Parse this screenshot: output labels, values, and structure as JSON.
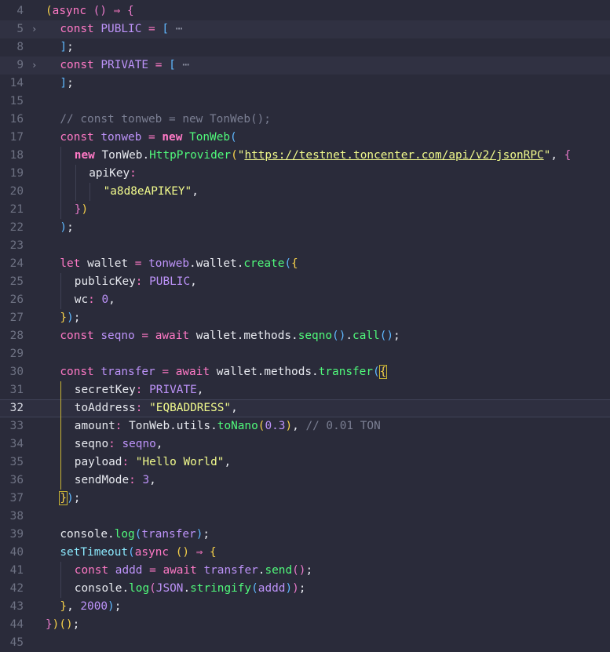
{
  "editor": {
    "lines": [
      {
        "n": 4,
        "indent": 0,
        "tokens": [
          [
            "(",
            "p1"
          ],
          [
            "async",
            "kw"
          ],
          [
            " ",
            "plain"
          ],
          [
            "()",
            "p2"
          ],
          [
            " ",
            "plain"
          ],
          [
            "⇒",
            "op"
          ],
          [
            " ",
            "plain"
          ],
          [
            "{",
            "p2"
          ]
        ]
      },
      {
        "n": 5,
        "indent": 1,
        "fold": true,
        "hl": true,
        "tokens": [
          [
            "const",
            "kw"
          ],
          [
            " ",
            "plain"
          ],
          [
            "PUBLIC",
            "const"
          ],
          [
            " ",
            "plain"
          ],
          [
            "=",
            "op"
          ],
          [
            " ",
            "plain"
          ],
          [
            "[",
            "p3"
          ],
          [
            " ",
            "plain"
          ],
          [
            "⋯",
            "ellipsis"
          ]
        ]
      },
      {
        "n": 8,
        "indent": 1,
        "tokens": [
          [
            "]",
            "p3"
          ],
          [
            ";",
            "plain"
          ]
        ]
      },
      {
        "n": 9,
        "indent": 1,
        "fold": true,
        "hl": true,
        "tokens": [
          [
            "const",
            "kw"
          ],
          [
            " ",
            "plain"
          ],
          [
            "PRIVATE",
            "const"
          ],
          [
            " ",
            "plain"
          ],
          [
            "=",
            "op"
          ],
          [
            " ",
            "plain"
          ],
          [
            "[",
            "p3"
          ],
          [
            " ",
            "plain"
          ],
          [
            "⋯",
            "ellipsis"
          ]
        ]
      },
      {
        "n": 14,
        "indent": 1,
        "tokens": [
          [
            "]",
            "p3"
          ],
          [
            ";",
            "plain"
          ]
        ]
      },
      {
        "n": 15,
        "indent": 1,
        "tokens": []
      },
      {
        "n": 16,
        "indent": 1,
        "tokens": [
          [
            "// const tonweb = new TonWeb();",
            "cmt"
          ]
        ]
      },
      {
        "n": 17,
        "indent": 1,
        "tokens": [
          [
            "const",
            "kw"
          ],
          [
            " ",
            "plain"
          ],
          [
            "tonweb",
            "var"
          ],
          [
            " ",
            "plain"
          ],
          [
            "=",
            "op"
          ],
          [
            " ",
            "plain"
          ],
          [
            "new",
            "new"
          ],
          [
            " ",
            "plain"
          ],
          [
            "TonWeb",
            "fn"
          ],
          [
            "(",
            "p3"
          ]
        ]
      },
      {
        "n": 18,
        "indent": 2,
        "tokens": [
          [
            "new",
            "new"
          ],
          [
            " ",
            "plain"
          ],
          [
            "TonWeb",
            "plain"
          ],
          [
            ".",
            "plain"
          ],
          [
            "HttpProvider",
            "fn"
          ],
          [
            "(",
            "p1"
          ],
          [
            "\"",
            "str"
          ],
          [
            "https://testnet.toncenter.com/api/v2/jsonRPC",
            "url"
          ],
          [
            "\"",
            "str"
          ],
          [
            ", ",
            "plain"
          ],
          [
            "{",
            "p2"
          ]
        ]
      },
      {
        "n": 19,
        "indent": 3,
        "tokens": [
          [
            "apiKey",
            "key"
          ],
          [
            ":",
            "op"
          ]
        ]
      },
      {
        "n": 20,
        "indent": 4,
        "tokens": [
          [
            "\"a8d8eAPIKEY\"",
            "str"
          ],
          [
            ",",
            "plain"
          ]
        ]
      },
      {
        "n": 21,
        "indent": 2,
        "tokens": [
          [
            "}",
            "p2"
          ],
          [
            ")",
            "p1"
          ]
        ]
      },
      {
        "n": 22,
        "indent": 1,
        "tokens": [
          [
            ")",
            "p3"
          ],
          [
            ";",
            "plain"
          ]
        ]
      },
      {
        "n": 23,
        "indent": 1,
        "tokens": []
      },
      {
        "n": 24,
        "indent": 1,
        "tokens": [
          [
            "let",
            "kw"
          ],
          [
            " ",
            "plain"
          ],
          [
            "wallet",
            "plain"
          ],
          [
            " ",
            "plain"
          ],
          [
            "=",
            "op"
          ],
          [
            " ",
            "plain"
          ],
          [
            "tonweb",
            "var"
          ],
          [
            ".",
            "plain"
          ],
          [
            "wallet",
            "plain"
          ],
          [
            ".",
            "plain"
          ],
          [
            "create",
            "fn"
          ],
          [
            "(",
            "p3"
          ],
          [
            "{",
            "p1"
          ]
        ]
      },
      {
        "n": 25,
        "indent": 2,
        "tokens": [
          [
            "publicKey",
            "key"
          ],
          [
            ":",
            "op"
          ],
          [
            " ",
            "plain"
          ],
          [
            "PUBLIC",
            "const"
          ],
          [
            ",",
            "plain"
          ]
        ]
      },
      {
        "n": 26,
        "indent": 2,
        "tokens": [
          [
            "wc",
            "key"
          ],
          [
            ":",
            "op"
          ],
          [
            " ",
            "plain"
          ],
          [
            "0",
            "num"
          ],
          [
            ",",
            "plain"
          ]
        ]
      },
      {
        "n": 27,
        "indent": 1,
        "tokens": [
          [
            "}",
            "p1"
          ],
          [
            ")",
            "p3"
          ],
          [
            ";",
            "plain"
          ]
        ]
      },
      {
        "n": 28,
        "indent": 1,
        "tokens": [
          [
            "const",
            "kw"
          ],
          [
            " ",
            "plain"
          ],
          [
            "seqno",
            "var"
          ],
          [
            " ",
            "plain"
          ],
          [
            "=",
            "op"
          ],
          [
            " ",
            "plain"
          ],
          [
            "await",
            "kw"
          ],
          [
            " ",
            "plain"
          ],
          [
            "wallet",
            "plain"
          ],
          [
            ".",
            "plain"
          ],
          [
            "methods",
            "plain"
          ],
          [
            ".",
            "plain"
          ],
          [
            "seqno",
            "fn"
          ],
          [
            "()",
            "p3"
          ],
          [
            ".",
            "plain"
          ],
          [
            "call",
            "fn"
          ],
          [
            "()",
            "p3"
          ],
          [
            ";",
            "plain"
          ]
        ]
      },
      {
        "n": 29,
        "indent": 1,
        "tokens": []
      },
      {
        "n": 30,
        "indent": 1,
        "tokens": [
          [
            "const",
            "kw"
          ],
          [
            " ",
            "plain"
          ],
          [
            "transfer",
            "var"
          ],
          [
            " ",
            "plain"
          ],
          [
            "=",
            "op"
          ],
          [
            " ",
            "plain"
          ],
          [
            "await",
            "kw"
          ],
          [
            " ",
            "plain"
          ],
          [
            "wallet",
            "plain"
          ],
          [
            ".",
            "plain"
          ],
          [
            "methods",
            "plain"
          ],
          [
            ".",
            "plain"
          ],
          [
            "transfer",
            "fn"
          ],
          [
            "(",
            "p3"
          ],
          [
            "{",
            "p1 box"
          ]
        ]
      },
      {
        "n": 31,
        "indent": 2,
        "active": true,
        "tokens": [
          [
            "secretKey",
            "key"
          ],
          [
            ":",
            "op"
          ],
          [
            " ",
            "plain"
          ],
          [
            "PRIVATE",
            "const"
          ],
          [
            ",",
            "plain"
          ]
        ]
      },
      {
        "n": 32,
        "indent": 2,
        "active": true,
        "cur": true,
        "tokens": [
          [
            "toAddress",
            "key"
          ],
          [
            ":",
            "op"
          ],
          [
            " ",
            "plain"
          ],
          [
            "\"EQBADDRESS\"",
            "str"
          ],
          [
            ",",
            "plain"
          ]
        ]
      },
      {
        "n": 33,
        "indent": 2,
        "active": true,
        "tokens": [
          [
            "amount",
            "key"
          ],
          [
            ":",
            "op"
          ],
          [
            " ",
            "plain"
          ],
          [
            "TonWeb",
            "plain"
          ],
          [
            ".",
            "plain"
          ],
          [
            "utils",
            "plain"
          ],
          [
            ".",
            "plain"
          ],
          [
            "toNano",
            "fn"
          ],
          [
            "(",
            "p1"
          ],
          [
            "0.3",
            "num"
          ],
          [
            ")",
            "p1"
          ],
          [
            ", ",
            "plain"
          ],
          [
            "// 0.01 TON",
            "cmt"
          ]
        ]
      },
      {
        "n": 34,
        "indent": 2,
        "active": true,
        "tokens": [
          [
            "seqno",
            "key"
          ],
          [
            ":",
            "op"
          ],
          [
            " ",
            "plain"
          ],
          [
            "seqno",
            "var"
          ],
          [
            ",",
            "plain"
          ]
        ]
      },
      {
        "n": 35,
        "indent": 2,
        "active": true,
        "tokens": [
          [
            "payload",
            "key"
          ],
          [
            ":",
            "op"
          ],
          [
            " ",
            "plain"
          ],
          [
            "\"Hello World\"",
            "str"
          ],
          [
            ",",
            "plain"
          ]
        ]
      },
      {
        "n": 36,
        "indent": 2,
        "active": true,
        "tokens": [
          [
            "sendMode",
            "key"
          ],
          [
            ":",
            "op"
          ],
          [
            " ",
            "plain"
          ],
          [
            "3",
            "num"
          ],
          [
            ",",
            "plain"
          ]
        ]
      },
      {
        "n": 37,
        "indent": 1,
        "tokens": [
          [
            "}",
            "p1 box"
          ],
          [
            ")",
            "p3"
          ],
          [
            ";",
            "plain"
          ]
        ]
      },
      {
        "n": 38,
        "indent": 1,
        "tokens": []
      },
      {
        "n": 39,
        "indent": 1,
        "tokens": [
          [
            "console",
            "plain"
          ],
          [
            ".",
            "plain"
          ],
          [
            "log",
            "fn"
          ],
          [
            "(",
            "p3"
          ],
          [
            "transfer",
            "var"
          ],
          [
            ")",
            "p3"
          ],
          [
            ";",
            "plain"
          ]
        ]
      },
      {
        "n": 40,
        "indent": 1,
        "tokens": [
          [
            "setTimeout",
            "cls"
          ],
          [
            "(",
            "p3"
          ],
          [
            "async",
            "kw"
          ],
          [
            " ",
            "plain"
          ],
          [
            "()",
            "p1"
          ],
          [
            " ",
            "plain"
          ],
          [
            "⇒",
            "op"
          ],
          [
            " ",
            "plain"
          ],
          [
            "{",
            "p1"
          ]
        ]
      },
      {
        "n": 41,
        "indent": 2,
        "tokens": [
          [
            "const",
            "kw"
          ],
          [
            " ",
            "plain"
          ],
          [
            "addd",
            "var"
          ],
          [
            " ",
            "plain"
          ],
          [
            "=",
            "op"
          ],
          [
            " ",
            "plain"
          ],
          [
            "await",
            "kw"
          ],
          [
            " ",
            "plain"
          ],
          [
            "transfer",
            "var"
          ],
          [
            ".",
            "plain"
          ],
          [
            "send",
            "fn"
          ],
          [
            "()",
            "p2"
          ],
          [
            ";",
            "plain"
          ]
        ]
      },
      {
        "n": 42,
        "indent": 2,
        "tokens": [
          [
            "console",
            "plain"
          ],
          [
            ".",
            "plain"
          ],
          [
            "log",
            "fn"
          ],
          [
            "(",
            "p2"
          ],
          [
            "JSON",
            "const"
          ],
          [
            ".",
            "plain"
          ],
          [
            "stringify",
            "fn"
          ],
          [
            "(",
            "p3"
          ],
          [
            "addd",
            "var"
          ],
          [
            ")",
            "p3"
          ],
          [
            ")",
            "p2"
          ],
          [
            ";",
            "plain"
          ]
        ]
      },
      {
        "n": 43,
        "indent": 1,
        "tokens": [
          [
            "}",
            "p1"
          ],
          [
            ", ",
            "plain"
          ],
          [
            "2000",
            "num"
          ],
          [
            ")",
            "p3"
          ],
          [
            ";",
            "plain"
          ]
        ]
      },
      {
        "n": 44,
        "indent": 0,
        "tokens": [
          [
            "}",
            "p2"
          ],
          [
            ")",
            "p1"
          ],
          [
            "()",
            "p1"
          ],
          [
            ";",
            "plain"
          ]
        ]
      },
      {
        "n": 45,
        "indent": 0,
        "tokens": []
      }
    ]
  },
  "colors": {
    "background": "#2a2b3a",
    "keyword": "#ff79c6",
    "function": "#50fa7b",
    "string": "#f1fa8c",
    "constant": "#bd93f9",
    "comment": "#7a7e92",
    "active_guide": "#c9b534"
  }
}
